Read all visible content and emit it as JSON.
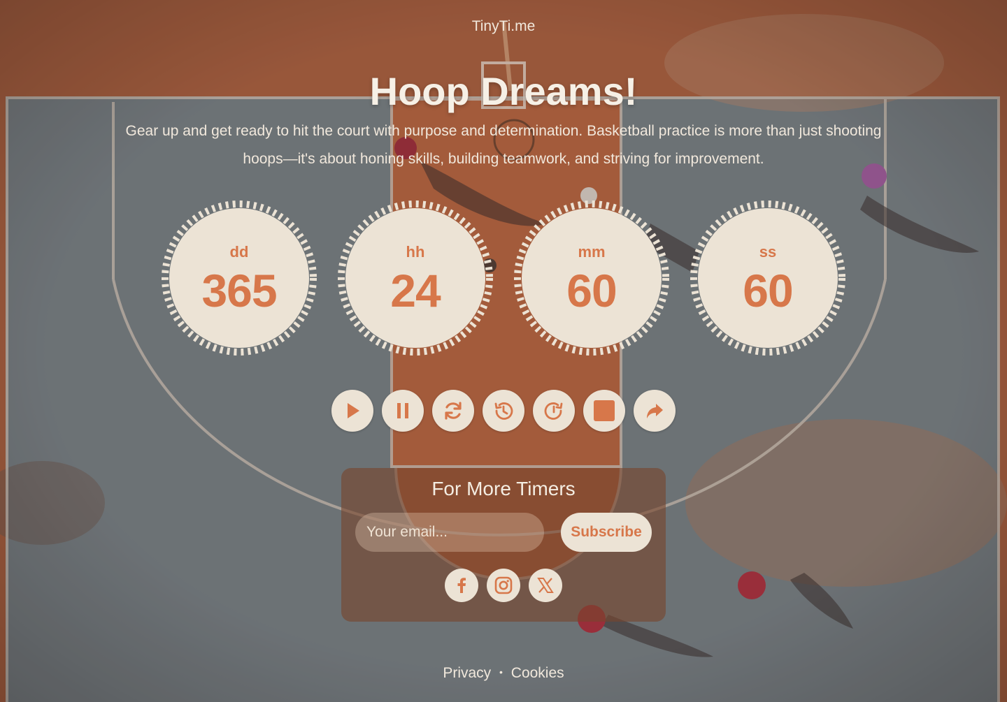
{
  "brand": "TinyTi.me",
  "title": "Hoop Dreams!",
  "description": "Gear up and get ready to hit the court with purpose and determination. Basketball practice is more than just shooting hoops—it's about honing skills, building teamwork, and striving for improvement.",
  "countdown": [
    {
      "label": "dd",
      "value": "365"
    },
    {
      "label": "hh",
      "value": "24"
    },
    {
      "label": "mm",
      "value": "60"
    },
    {
      "label": "ss",
      "value": "60"
    }
  ],
  "controls": [
    {
      "name": "play",
      "icon": "play-icon"
    },
    {
      "name": "pause",
      "icon": "pause-icon"
    },
    {
      "name": "restart",
      "icon": "refresh-icon"
    },
    {
      "name": "rewind",
      "icon": "history-back-icon"
    },
    {
      "name": "forward",
      "icon": "history-forward-icon"
    },
    {
      "name": "stop",
      "icon": "stop-icon"
    },
    {
      "name": "share",
      "icon": "share-icon"
    }
  ],
  "subscribe": {
    "title": "For More Timers",
    "email_placeholder": "Your email...",
    "email_value": "",
    "button_label": "Subscribe"
  },
  "social": [
    {
      "name": "facebook",
      "icon": "facebook-icon"
    },
    {
      "name": "instagram",
      "icon": "instagram-icon"
    },
    {
      "name": "x",
      "icon": "x-twitter-icon"
    }
  ],
  "footer": {
    "privacy": "Privacy",
    "separator": "•",
    "cookies": "Cookies"
  },
  "colors": {
    "accent": "#d7774a",
    "button_bg": "#ece3d5",
    "card_bg": "#78462d",
    "court_blue": "#6f7f87",
    "court_orange": "#b4633f"
  }
}
